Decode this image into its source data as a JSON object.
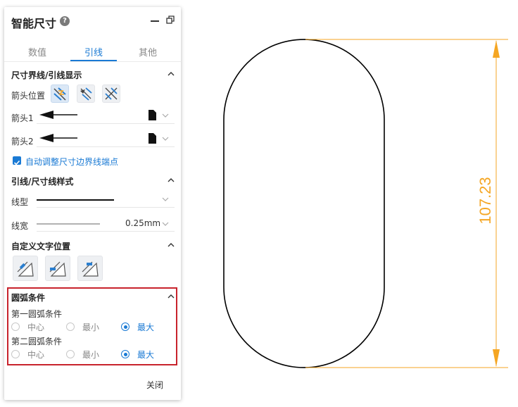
{
  "panel": {
    "title": "智能尺寸",
    "help_icon": "help-icon",
    "minimize_icon": "minimize-icon",
    "restore_icon": "restore-window-icon",
    "tabs": [
      {
        "label": "数值",
        "active": false
      },
      {
        "label": "引线",
        "active": true
      },
      {
        "label": "其他",
        "active": false
      }
    ],
    "section_extension": {
      "title": "尺寸界线/引线显示",
      "arrow_position_label": "箭头位置",
      "arrow1_label": "箭头1",
      "arrow2_label": "箭头2",
      "auto_adjust_label": "自动调整尺寸边界线端点",
      "auto_adjust_checked": true
    },
    "section_style": {
      "title": "引线/尺寸线样式",
      "line_type_label": "线型",
      "line_width_label": "线宽",
      "line_width_value": "0.25mm"
    },
    "section_text_pos": {
      "title": "自定义文字位置"
    },
    "section_arc": {
      "title": "圆弧条件",
      "first_label": "第一圆弧条件",
      "second_label": "第二圆弧条件",
      "options": [
        "中心",
        "最小",
        "最大"
      ],
      "first_selected": "最大",
      "second_selected": "最大"
    },
    "close_label": "关闭"
  },
  "drawing": {
    "dimension_value": "107.23",
    "dimension_color": "#f5a623",
    "shape_color": "#000000"
  },
  "colors": {
    "accent": "#1a7ad4",
    "highlight_border": "#c8232c"
  }
}
